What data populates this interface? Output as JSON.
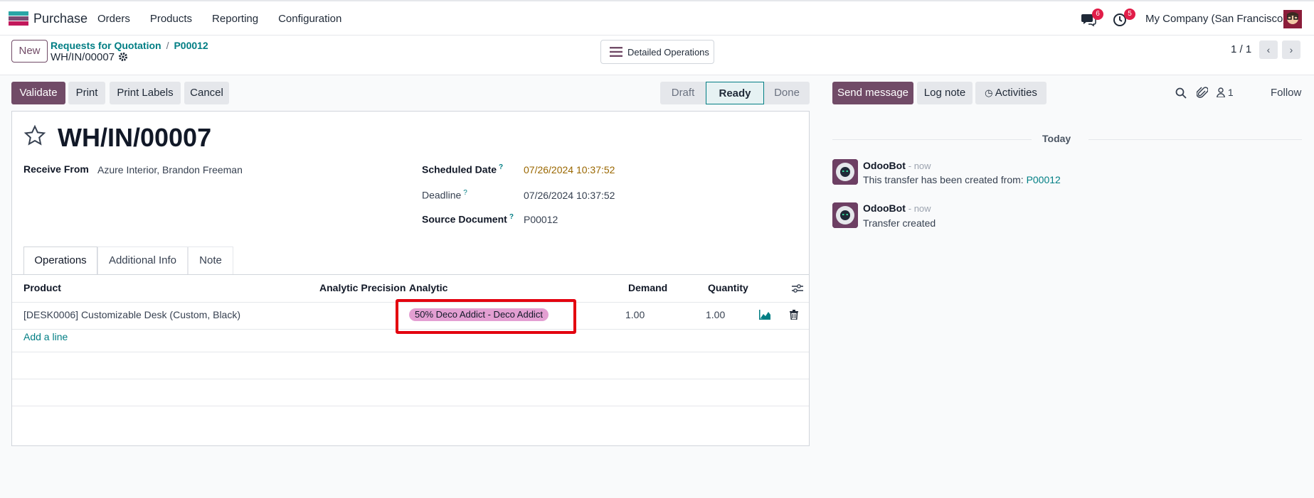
{
  "app": {
    "name": "Purchase"
  },
  "menu": [
    "Orders",
    "Products",
    "Reporting",
    "Configuration"
  ],
  "systray": {
    "messages_count": "6",
    "activities_count": "5",
    "company": "My Company (San Francisco)"
  },
  "control": {
    "new_label": "New",
    "breadcrumbs": [
      "Requests for Quotation",
      "P00012"
    ],
    "breadcrumb_sep": "/",
    "current": "WH/IN/00007",
    "detailed_ops_label": "Detailed Operations",
    "pager": "1 / 1"
  },
  "actions": {
    "validate": "Validate",
    "print": "Print",
    "print_labels": "Print Labels",
    "cancel": "Cancel"
  },
  "status": {
    "draft": "Draft",
    "ready": "Ready",
    "done": "Done",
    "current": "Ready"
  },
  "record": {
    "title": "WH/IN/00007",
    "receive_from_label": "Receive From",
    "receive_from": "Azure Interior, Brandon Freeman",
    "scheduled_label": "Scheduled Date",
    "scheduled": "07/26/2024 10:37:52",
    "deadline_label": "Deadline",
    "deadline": "07/26/2024 10:37:52",
    "source_label": "Source Document",
    "source": "P00012",
    "help_mark": "?"
  },
  "tabs": [
    "Operations",
    "Additional Info",
    "Note"
  ],
  "table": {
    "headers": {
      "product": "Product",
      "precision": "Analytic Precision",
      "analytic": "Analytic",
      "demand": "Demand",
      "quantity": "Quantity"
    },
    "rows": [
      {
        "product": "[DESK0006] Customizable Desk (Custom, Black)",
        "analytic": "50% Deco Addict - Deco Addict",
        "demand": "1.00",
        "quantity": "1.00"
      }
    ],
    "add_line": "Add a line"
  },
  "chatter": {
    "send_message": "Send message",
    "log_note": "Log note",
    "activities": "Activities",
    "followers_count": "1",
    "follow": "Follow",
    "today": "Today",
    "messages": [
      {
        "author": "OdooBot",
        "time": "- now",
        "body": "This transfer has been created from: ",
        "link": "P00012"
      },
      {
        "author": "OdooBot",
        "time": "- now",
        "body": "Transfer created",
        "link": ""
      }
    ]
  },
  "colors": {
    "brand": "#714b67",
    "link": "#017e84",
    "tag": "#e39fd2",
    "highlight": "#e3000f"
  }
}
